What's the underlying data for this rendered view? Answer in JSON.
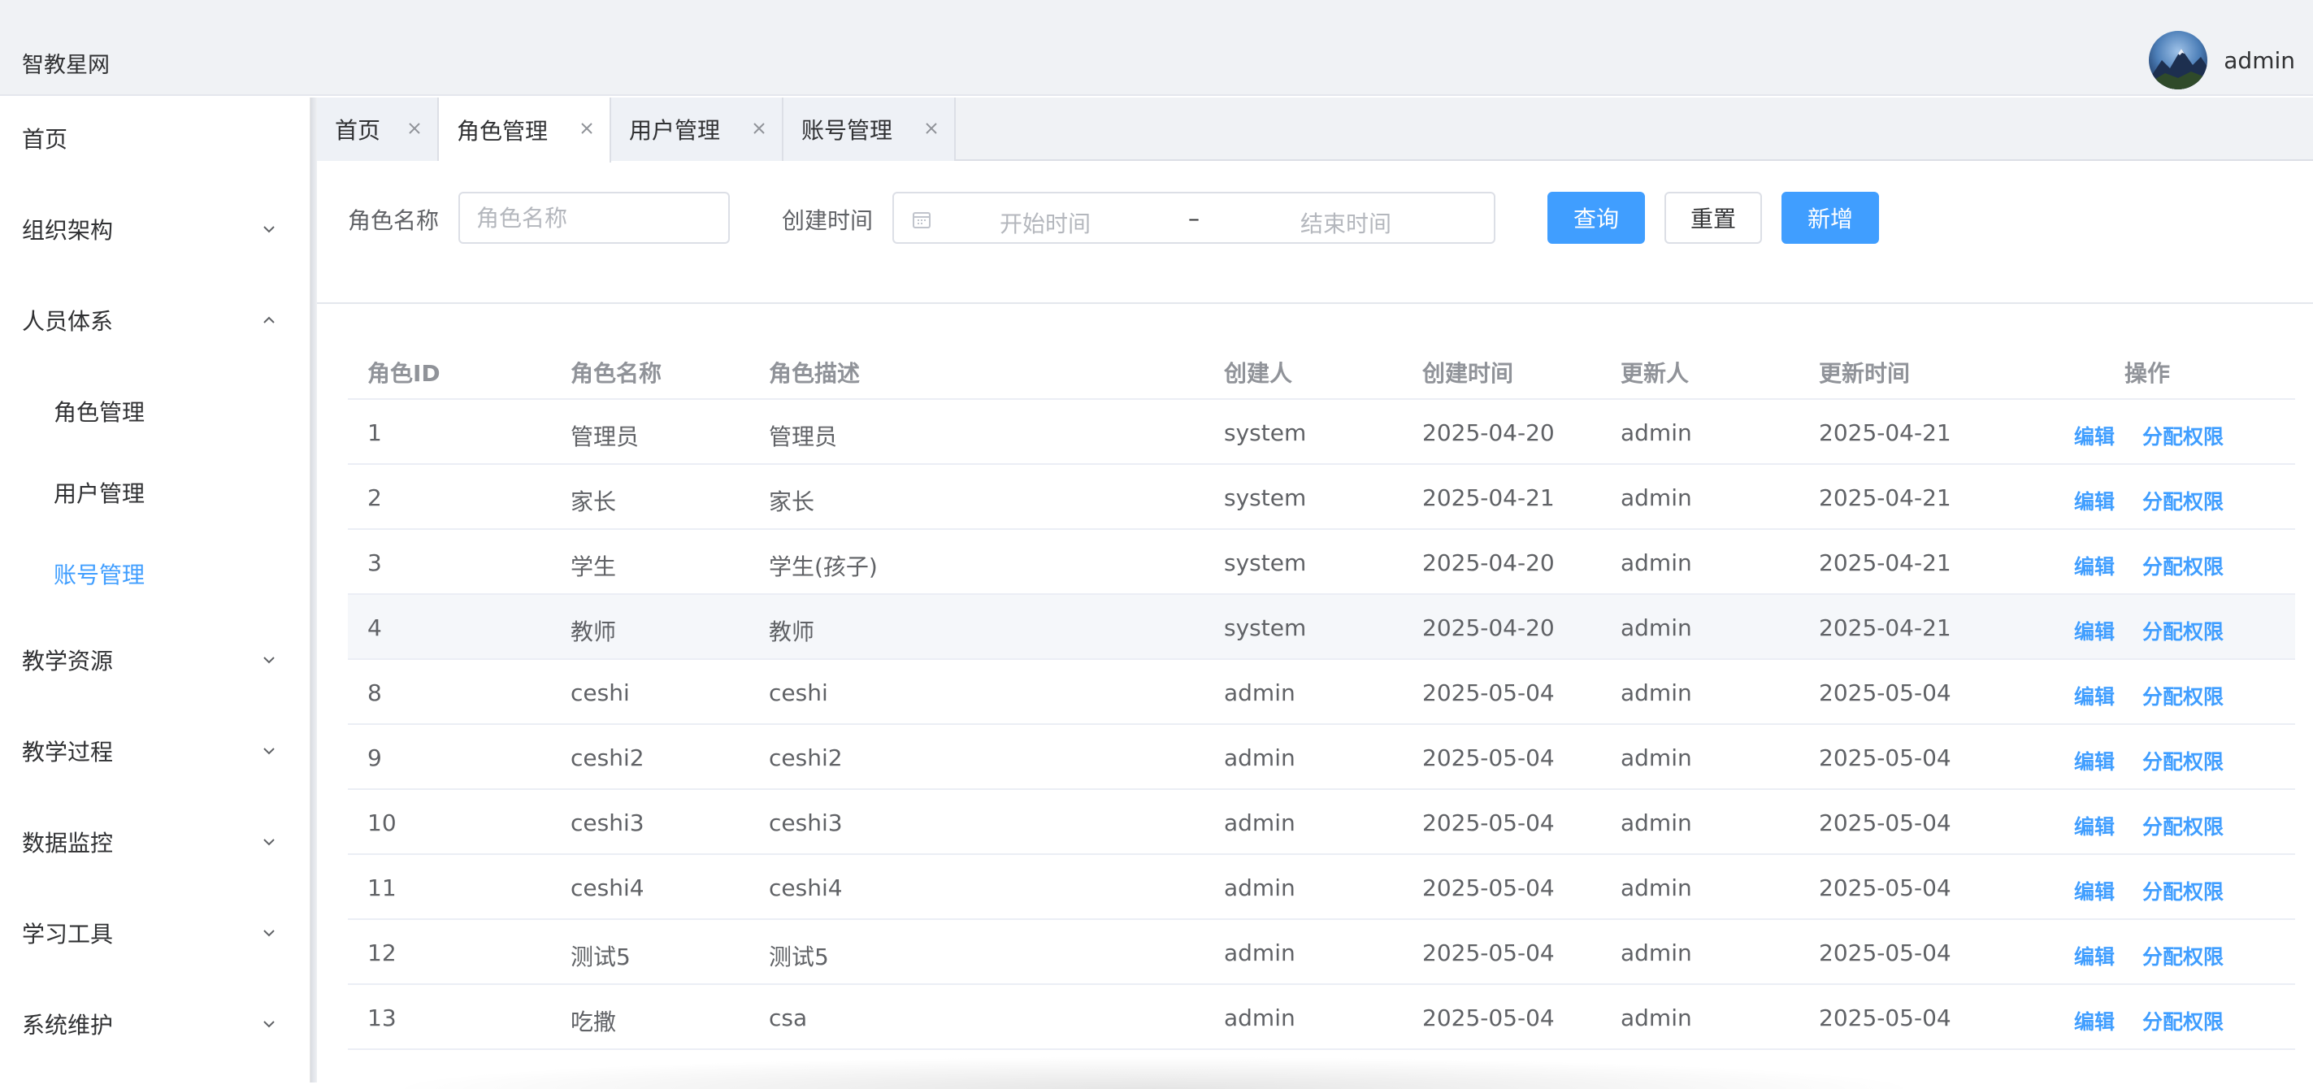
{
  "header": {
    "brand": "智教星网",
    "user": {
      "name": "admin",
      "avatar_icon": "user-avatar"
    }
  },
  "sidebar": {
    "items": [
      {
        "label": "首页",
        "expanded": false,
        "has_children": false
      },
      {
        "label": "组织架构",
        "expanded": false,
        "has_children": true
      },
      {
        "label": "人员体系",
        "expanded": true,
        "has_children": true,
        "children": [
          {
            "label": "角色管理",
            "active": false
          },
          {
            "label": "用户管理",
            "active": false
          },
          {
            "label": "账号管理",
            "active": true
          }
        ]
      },
      {
        "label": "教学资源",
        "expanded": false,
        "has_children": true
      },
      {
        "label": "教学过程",
        "expanded": false,
        "has_children": true
      },
      {
        "label": "数据监控",
        "expanded": false,
        "has_children": true
      },
      {
        "label": "学习工具",
        "expanded": false,
        "has_children": true
      },
      {
        "label": "系统维护",
        "expanded": false,
        "has_children": true
      }
    ]
  },
  "tabs": [
    {
      "label": "首页",
      "active": false
    },
    {
      "label": "角色管理",
      "active": true
    },
    {
      "label": "用户管理",
      "active": false
    },
    {
      "label": "账号管理",
      "active": false
    }
  ],
  "search": {
    "role_name_label": "角色名称",
    "role_name_placeholder": "角色名称",
    "role_name_value": "",
    "created_time_label": "创建时间",
    "start_placeholder": "开始时间",
    "range_separator": "–",
    "end_placeholder": "结束时间",
    "query_label": "查询",
    "reset_label": "重置",
    "add_label": "新增"
  },
  "table": {
    "columns": [
      "角色ID",
      "角色名称",
      "角色描述",
      "创建人",
      "创建时间",
      "更新人",
      "更新时间",
      "操作"
    ],
    "action_edit": "编辑",
    "action_assign": "分配权限",
    "rows": [
      {
        "id": "1",
        "name": "管理员",
        "desc": "管理员",
        "creator": "system",
        "created": "2025-04-20",
        "updater": "admin",
        "updated": "2025-04-21"
      },
      {
        "id": "2",
        "name": "家长",
        "desc": "家长",
        "creator": "system",
        "created": "2025-04-21",
        "updater": "admin",
        "updated": "2025-04-21"
      },
      {
        "id": "3",
        "name": "学生",
        "desc": "学生(孩子)",
        "creator": "system",
        "created": "2025-04-20",
        "updater": "admin",
        "updated": "2025-04-21"
      },
      {
        "id": "4",
        "name": "教师",
        "desc": "教师",
        "creator": "system",
        "created": "2025-04-20",
        "updater": "admin",
        "updated": "2025-04-21",
        "hovered": true
      },
      {
        "id": "8",
        "name": "ceshi",
        "desc": "ceshi",
        "creator": "admin",
        "created": "2025-05-04",
        "updater": "admin",
        "updated": "2025-05-04"
      },
      {
        "id": "9",
        "name": "ceshi2",
        "desc": "ceshi2",
        "creator": "admin",
        "created": "2025-05-04",
        "updater": "admin",
        "updated": "2025-05-04"
      },
      {
        "id": "10",
        "name": "ceshi3",
        "desc": "ceshi3",
        "creator": "admin",
        "created": "2025-05-04",
        "updater": "admin",
        "updated": "2025-05-04"
      },
      {
        "id": "11",
        "name": "ceshi4",
        "desc": "ceshi4",
        "creator": "admin",
        "created": "2025-05-04",
        "updater": "admin",
        "updated": "2025-05-04"
      },
      {
        "id": "12",
        "name": "测试5",
        "desc": "测试5",
        "creator": "admin",
        "created": "2025-05-04",
        "updater": "admin",
        "updated": "2025-05-04"
      },
      {
        "id": "13",
        "name": "吃撒",
        "desc": "csa",
        "creator": "admin",
        "created": "2025-05-04",
        "updater": "admin",
        "updated": "2025-05-04"
      }
    ]
  },
  "colors": {
    "primary": "#409eff",
    "active_menu": "#409eff",
    "header_bg": "#f0f2f5",
    "text": "#303133",
    "muted": "#909399"
  }
}
